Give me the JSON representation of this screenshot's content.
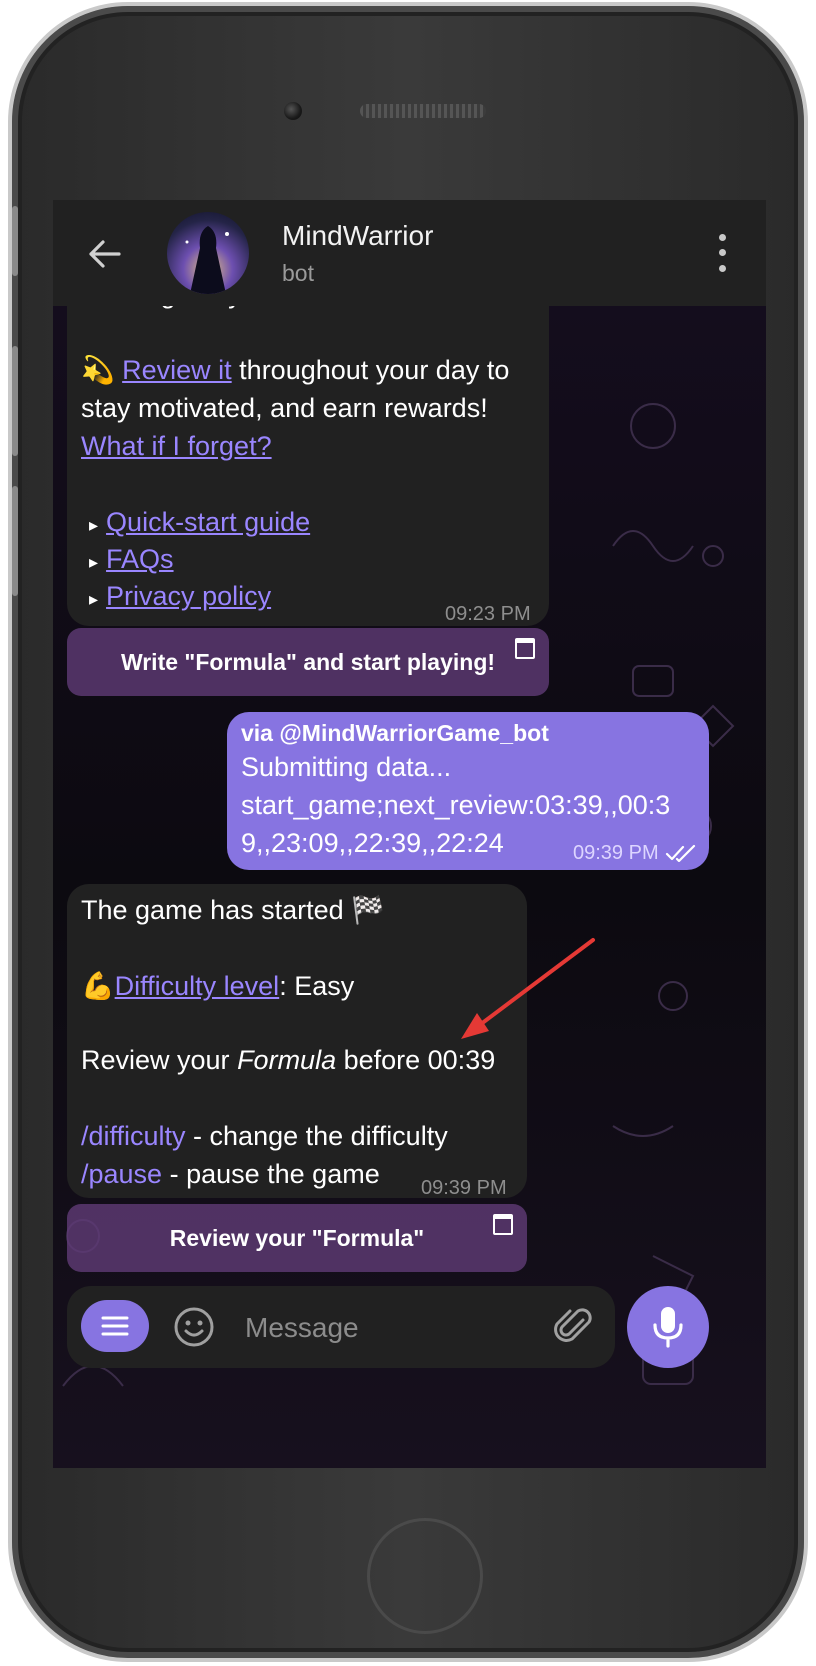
{
  "header": {
    "title": "MindWarrior",
    "subtitle": "bot"
  },
  "msg1": {
    "partial_line": "message to yourself.",
    "sparkle_emoji": "💫",
    "review_link": "Review it",
    "review_rest": " throughout your day to",
    "line3": "stay motivated, and earn rewards!",
    "forget_link": "What if I forget?",
    "bullet": "▸",
    "links": [
      "Quick-start guide",
      "FAQs",
      "Privacy policy"
    ],
    "time": "09:23 PM"
  },
  "button1": {
    "label": "Write \"Formula\" and start playing!"
  },
  "outgoing": {
    "via": "via @MindWarriorGame_bot",
    "line1": "Submitting data...",
    "line2": "start_game;next_review:03:39,,00:3",
    "line3": "9,,23:09,,22:39,,22:24",
    "time": "09:39 PM"
  },
  "msg2": {
    "started": "The game has started",
    "flag_emoji": "🏁",
    "muscle_emoji": "💪",
    "difficulty_link": "Difficulty level",
    "difficulty_value": ": Easy",
    "review_prefix": "Review your ",
    "review_formula": "Formula",
    "review_suffix": " before 00:39",
    "cmd1": "/difficulty",
    "cmd1_desc": " - change the difficulty",
    "cmd2": "/pause",
    "cmd2_desc": " - pause the game",
    "time": "09:39 PM"
  },
  "button2": {
    "label": "Review your \"Formula\""
  },
  "input": {
    "placeholder": "Message",
    "value": ""
  },
  "colors": {
    "accent": "#8774e1",
    "link": "#9a86ff",
    "bubble": "#212121",
    "annotation_arrow": "#e53935"
  },
  "icons": {
    "back": "arrow-left",
    "more": "three-dots-vertical",
    "menu": "hamburger",
    "emoji": "smiley",
    "attach": "paperclip",
    "mic": "microphone",
    "read": "double-check",
    "web_app": "window"
  }
}
